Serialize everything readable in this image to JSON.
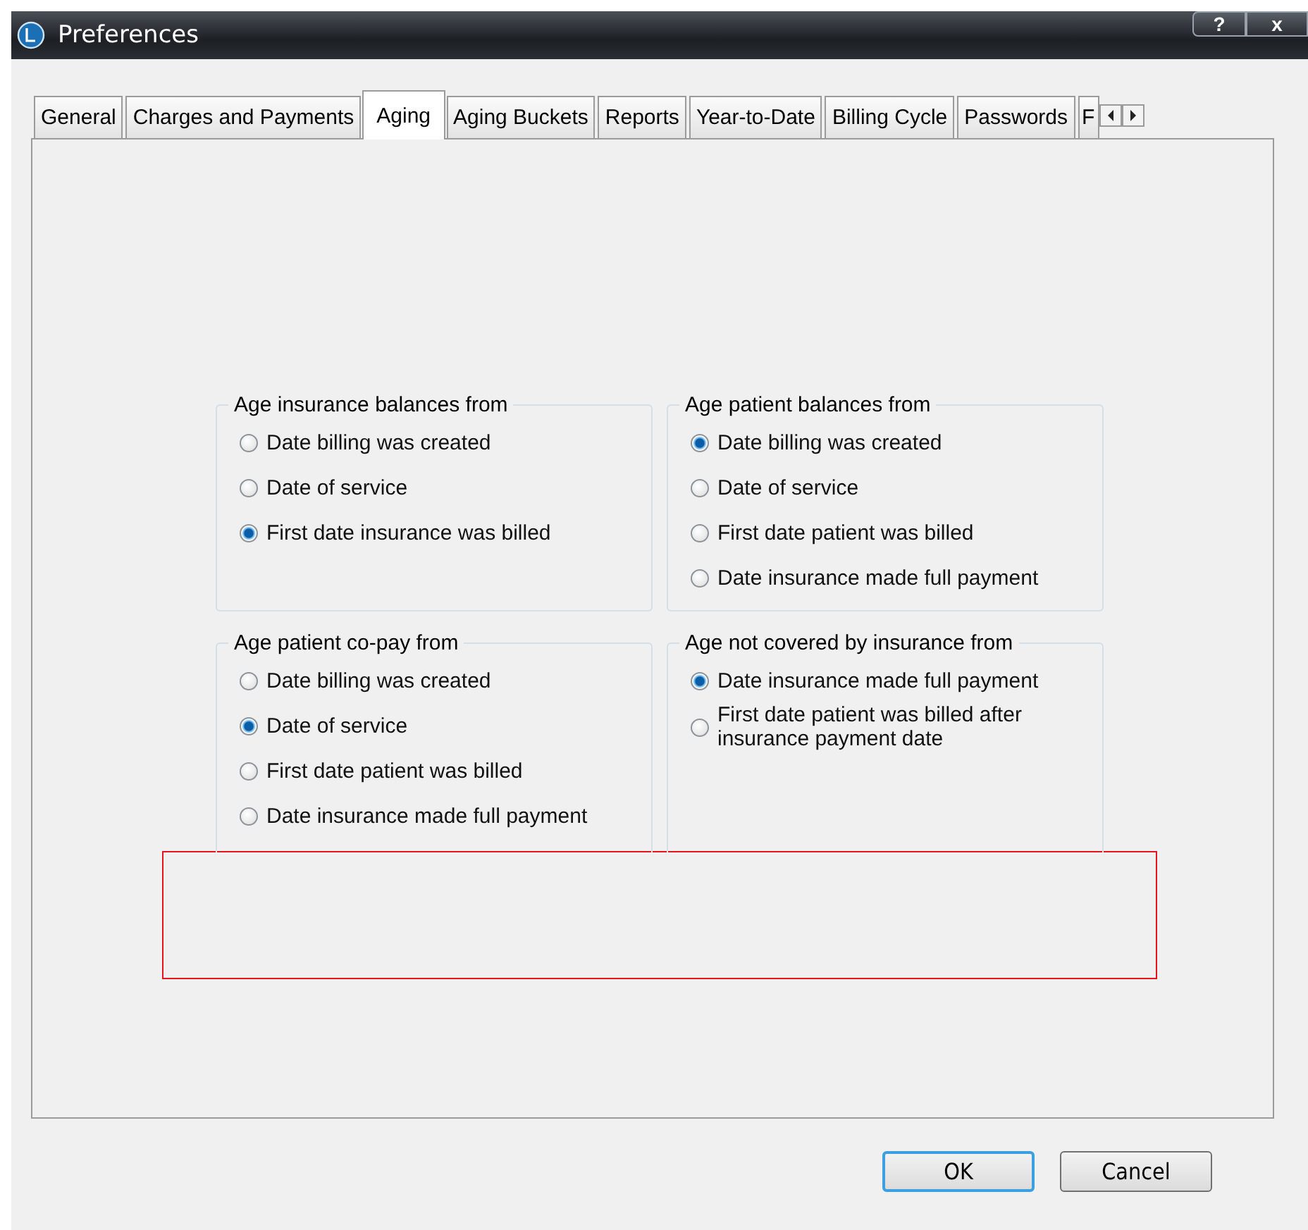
{
  "window": {
    "title": "Preferences",
    "controls": [
      "?",
      "x"
    ]
  },
  "tabs": [
    {
      "label": "General",
      "selected": false
    },
    {
      "label": "Charges and Payments",
      "selected": false
    },
    {
      "label": "Aging",
      "selected": true
    },
    {
      "label": "Aging Buckets",
      "selected": false
    },
    {
      "label": "Reports",
      "selected": false
    },
    {
      "label": "Year-to-Date",
      "selected": false
    },
    {
      "label": "Billing Cycle",
      "selected": false
    },
    {
      "label": "Passwords",
      "selected": false
    },
    {
      "label": "F",
      "selected": false
    }
  ],
  "groups": [
    {
      "title": "Age insurance balances from",
      "options": [
        {
          "label": "Date billing was created",
          "selected": false
        },
        {
          "label": "Date of service",
          "selected": false
        },
        {
          "label": "First date insurance was billed",
          "selected": true
        }
      ]
    },
    {
      "title": "Age patient balances from",
      "options": [
        {
          "label": "Date billing was created",
          "selected": true
        },
        {
          "label": "Date of service",
          "selected": false
        },
        {
          "label": "First date patient was billed",
          "selected": false
        },
        {
          "label": "Date insurance made full payment",
          "selected": false
        }
      ]
    },
    {
      "title": "Age patient co-pay from",
      "options": [
        {
          "label": "Date billing was created",
          "selected": false
        },
        {
          "label": "Date of service",
          "selected": true
        },
        {
          "label": "First date patient was billed",
          "selected": false
        },
        {
          "label": "Date insurance made full payment",
          "selected": false
        }
      ]
    },
    {
      "title": "Age not covered by insurance from",
      "options": [
        {
          "label": "Date insurance made full payment",
          "selected": true
        },
        {
          "label": "First date patient was billed after insurance payment date",
          "selected": false
        }
      ]
    }
  ],
  "buttons": [
    {
      "label": "OK",
      "default": true
    },
    {
      "label": "Cancel",
      "default": false
    }
  ]
}
